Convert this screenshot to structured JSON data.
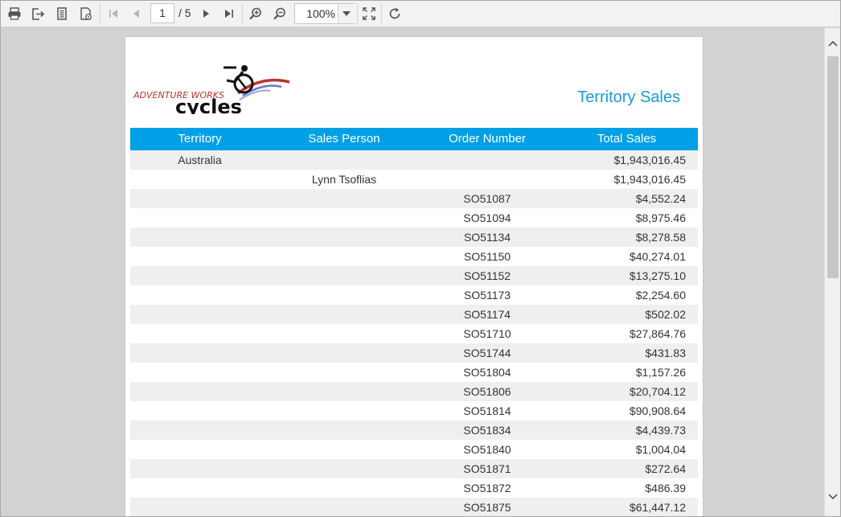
{
  "toolbar": {
    "icons": [
      "print-icon",
      "export-icon",
      "page-setup-icon",
      "print-layout-icon",
      "first-page-icon",
      "previous-page-icon",
      "next-page-icon",
      "last-page-icon",
      "zoom-in-icon",
      "zoom-out-icon",
      "fit-page-icon",
      "refresh-icon"
    ],
    "current_page": "1",
    "page_total": "/ 5",
    "zoom": "100%"
  },
  "report": {
    "logo_text_top": "ADVENTURE WORKS",
    "logo_text_bottom": "cycles",
    "title": "Territory Sales",
    "columns": [
      "Territory",
      "Sales Person",
      "Order Number",
      "Total Sales"
    ],
    "rows": [
      [
        "Australia",
        "",
        "",
        "$1,943,016.45"
      ],
      [
        "",
        "Lynn Tsoflias",
        "",
        "$1,943,016.45"
      ],
      [
        "",
        "",
        "SO51087",
        "$4,552.24"
      ],
      [
        "",
        "",
        "SO51094",
        "$8,975.46"
      ],
      [
        "",
        "",
        "SO51134",
        "$8,278.58"
      ],
      [
        "",
        "",
        "SO51150",
        "$40,274.01"
      ],
      [
        "",
        "",
        "SO51152",
        "$13,275.10"
      ],
      [
        "",
        "",
        "SO51173",
        "$2,254.60"
      ],
      [
        "",
        "",
        "SO51174",
        "$502.02"
      ],
      [
        "",
        "",
        "SO51710",
        "$27,864.76"
      ],
      [
        "",
        "",
        "SO51744",
        "$431.83"
      ],
      [
        "",
        "",
        "SO51804",
        "$1,157.26"
      ],
      [
        "",
        "",
        "SO51806",
        "$20,704.12"
      ],
      [
        "",
        "",
        "SO51814",
        "$90,908.64"
      ],
      [
        "",
        "",
        "SO51834",
        "$4,439.73"
      ],
      [
        "",
        "",
        "SO51840",
        "$1,004.04"
      ],
      [
        "",
        "",
        "SO51871",
        "$272.64"
      ],
      [
        "",
        "",
        "SO51872",
        "$486.39"
      ],
      [
        "",
        "",
        "SO51875",
        "$61,447.12"
      ]
    ]
  },
  "colors": {
    "header_bg": "#00a0e6",
    "title": "#1b9ad6",
    "row_shade": "#efefef"
  }
}
